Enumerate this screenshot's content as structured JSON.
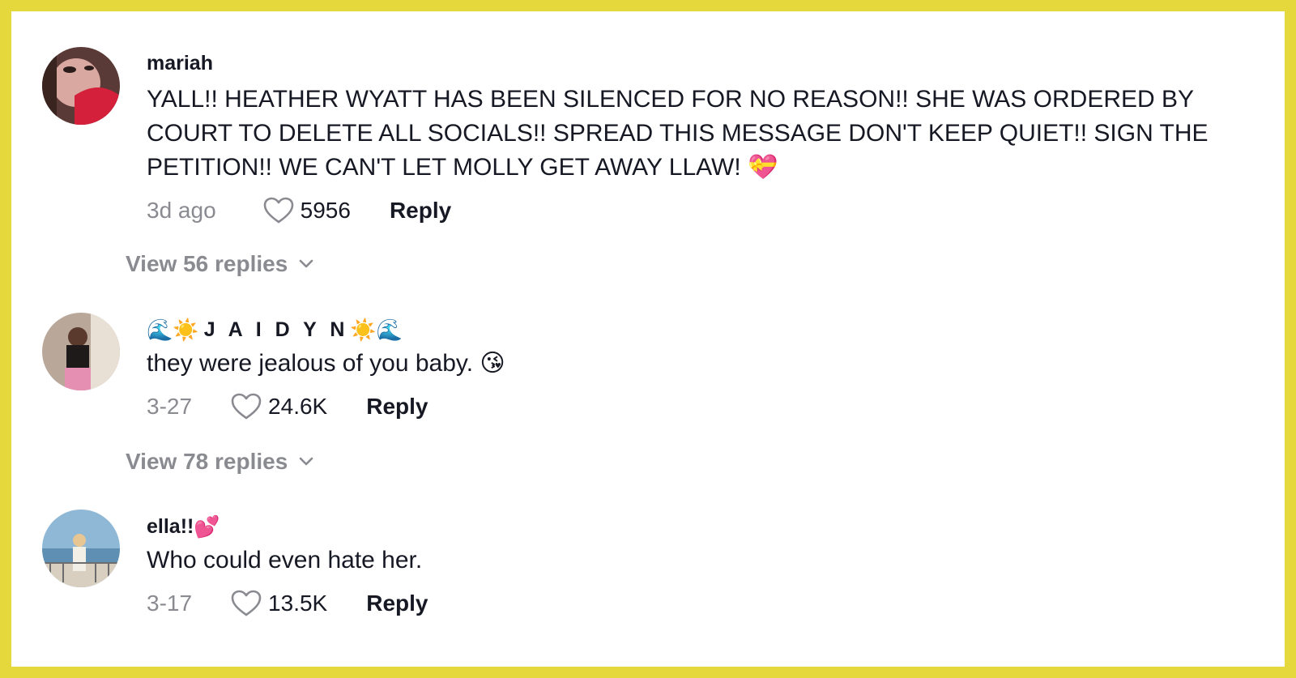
{
  "comments": [
    {
      "username": "mariah",
      "text": "YALL!! HEATHER WYATT HAS BEEN SILENCED FOR NO REASON!! SHE WAS ORDERED BY COURT TO DELETE ALL SOCIALS!! SPREAD THIS MESSAGE DON'T KEEP QUIET!! SIGN THE PETITION!! WE CAN'T LET MOLLY GET AWAY LLAW!",
      "emoji": "💝",
      "date": "3d ago",
      "likes": "5956",
      "reply_label": "Reply",
      "view_replies": "View 56 replies"
    },
    {
      "username": "J A I D Y N",
      "username_prefix": "🌊☀️",
      "username_suffix": "☀️🌊",
      "text": "they were jealous of you baby.",
      "emoji": "😘",
      "date": "3-27",
      "likes": "24.6K",
      "reply_label": "Reply",
      "view_replies": "View 78 replies"
    },
    {
      "username": "ella!!",
      "username_suffix": "💕",
      "text": "Who could even hate her.",
      "date": "3-17",
      "likes": "13.5K",
      "reply_label": "Reply"
    }
  ],
  "icons": {
    "like": "heart-outline-icon",
    "expand": "chevron-down-icon"
  },
  "colors": {
    "frame": "#e4d83c",
    "text": "#161823",
    "muted": "#8a8b91"
  }
}
